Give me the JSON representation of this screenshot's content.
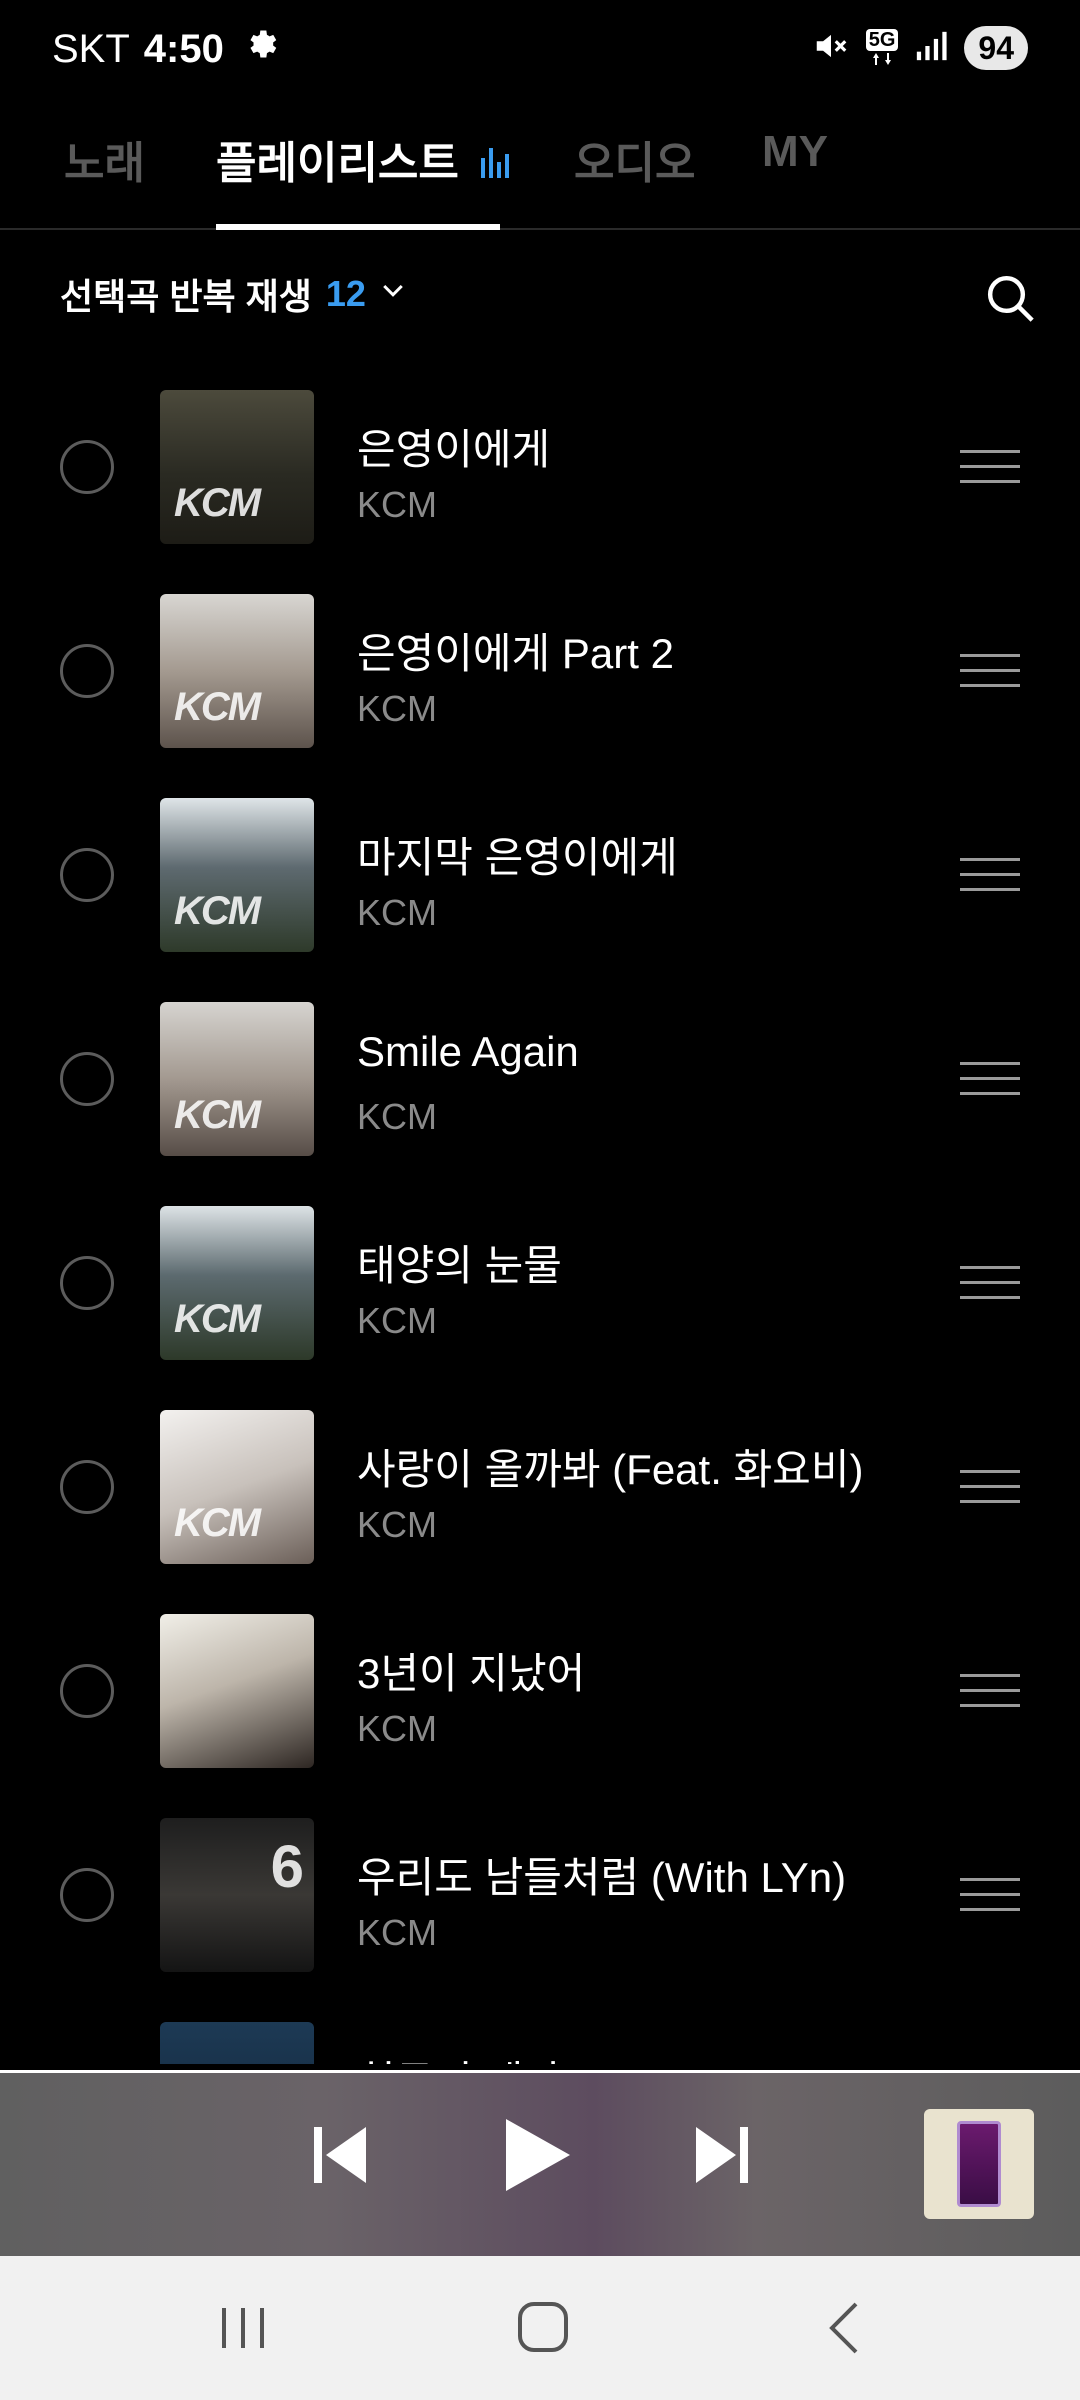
{
  "status_bar": {
    "carrier": "SKT",
    "time": "4:50",
    "network": "5G",
    "battery": "94"
  },
  "tabs": [
    {
      "label": "노래",
      "active": false
    },
    {
      "label": "플레이리스트",
      "active": true
    },
    {
      "label": "오디오",
      "active": false
    },
    {
      "label": "MY",
      "active": false
    }
  ],
  "options": {
    "repeat_label": "선택곡 반복 재생",
    "count": "12"
  },
  "songs": [
    {
      "title": "은영이에게",
      "artist": "KCM"
    },
    {
      "title": "은영이에게 Part 2",
      "artist": "KCM"
    },
    {
      "title": "마지막 은영이에게",
      "artist": "KCM"
    },
    {
      "title": "Smile Again",
      "artist": "KCM"
    },
    {
      "title": "태양의 눈물",
      "artist": "KCM"
    },
    {
      "title": "사랑이 올까봐 (Feat. 화요비)",
      "artist": "KCM"
    },
    {
      "title": "3년이 지났어",
      "artist": "KCM"
    },
    {
      "title": "우리도 남들처럼 (With LYn)",
      "artist": "KCM"
    },
    {
      "title": "친구의 계단",
      "artist": ""
    }
  ],
  "icons": {
    "settings": "gear-icon",
    "mute": "mute-icon",
    "signal": "signal-icon",
    "equalizer": "equalizer-icon",
    "search": "search-icon",
    "drag": "drag-handle-icon",
    "prev": "skip-previous-icon",
    "play": "play-icon",
    "next": "skip-next-icon"
  },
  "colors": {
    "accent": "#3a9cf0",
    "background": "#000000",
    "subtext": "#8a8a8a"
  }
}
